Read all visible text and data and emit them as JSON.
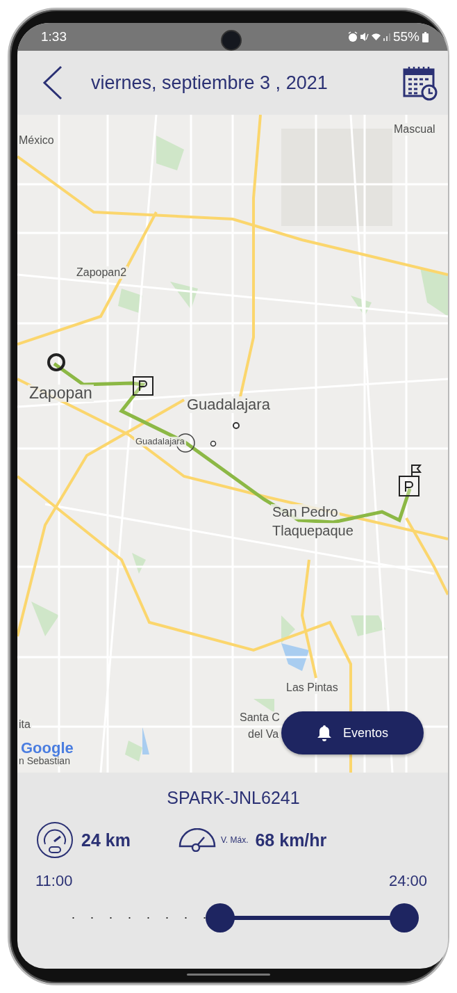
{
  "status_bar": {
    "time": "1:33",
    "battery": "55%"
  },
  "header": {
    "title": "viernes, septiembre 3 , 2021"
  },
  "map": {
    "labels": [
      {
        "text": "México"
      },
      {
        "text": "Mascual"
      },
      {
        "text": "Zapopan2"
      },
      {
        "text": "Zapopan"
      },
      {
        "text": "Guadalajara"
      },
      {
        "text": "Guadalajara"
      },
      {
        "text": "San Pedro"
      },
      {
        "text": "Tlaquepaque"
      },
      {
        "text": "Las Pintas"
      },
      {
        "text": "Santa C"
      },
      {
        "text": "del Va"
      },
      {
        "text": "ita"
      },
      {
        "text": "n Sebastian"
      }
    ],
    "logo": "Google",
    "events_button": "Eventos"
  },
  "vehicle": {
    "name": "SPARK-JNL6241",
    "distance": "24 km",
    "max_speed_label": "V. Máx.",
    "max_speed": "68 km/hr"
  },
  "timeline": {
    "start": "11:00",
    "end": "24:00",
    "thumbs": [
      {
        "level": 0.46
      },
      {
        "level": 1
      }
    ]
  }
}
